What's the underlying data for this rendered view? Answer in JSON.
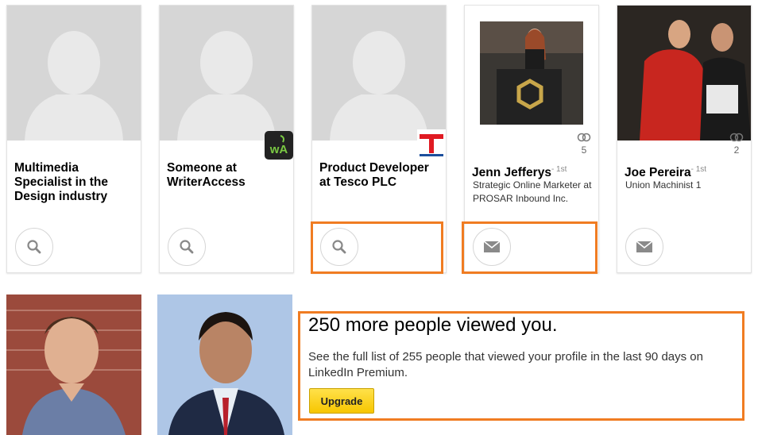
{
  "viewers": [
    {
      "name": "Multimedia Specialist in the Design industry",
      "headline": "",
      "degree": "",
      "action": "search-icon"
    },
    {
      "name": "Someone at WriterAccess",
      "headline": "",
      "degree": "",
      "action": "search-icon",
      "logo_text": "wA"
    },
    {
      "name": "Product Developer at Tesco PLC",
      "headline": "",
      "degree": "",
      "action": "search-icon"
    },
    {
      "name": "Jenn Jefferys",
      "degree": "- 1st",
      "headline": "Strategic Online Marketer at PROSAR Inbound Inc.",
      "connections": "5",
      "action": "mail-icon"
    },
    {
      "name": "Joe Pereira",
      "degree": "- 1st",
      "headline": "Union Machinist 1",
      "connections": "2",
      "action": "mail-icon"
    }
  ],
  "promo": {
    "title": "250 more people viewed you.",
    "text": "See the full list of 255 people that viewed your profile in the last 90 days on LinkedIn Premium.",
    "button": "Upgrade"
  },
  "colors": {
    "highlight": "#f07c22",
    "upgrade": "#f7c600"
  }
}
